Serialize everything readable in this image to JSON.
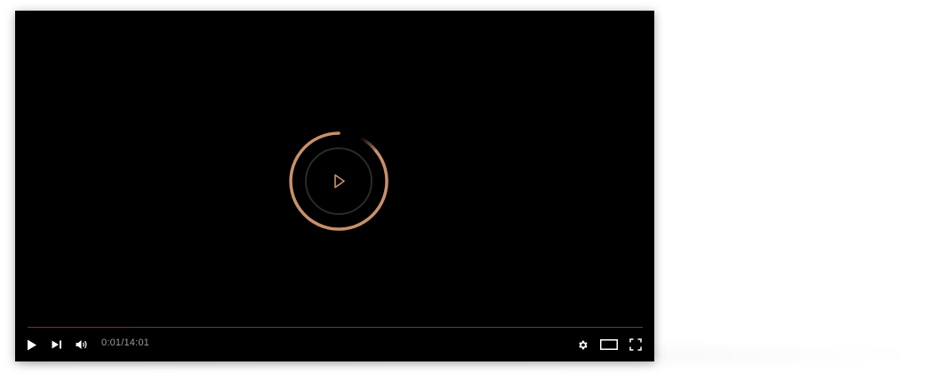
{
  "player": {
    "time_display": "0:01/14:01",
    "played_fraction": 0.17,
    "accent_color": "#c8906a",
    "progress_color": "#8b2b22"
  },
  "controls": {
    "left": [
      "play-icon",
      "next-icon",
      "volume-icon"
    ],
    "right": [
      "settings-icon",
      "theater-mode-icon",
      "fullscreen-icon"
    ]
  },
  "loader": {
    "icon": "play-icon"
  }
}
